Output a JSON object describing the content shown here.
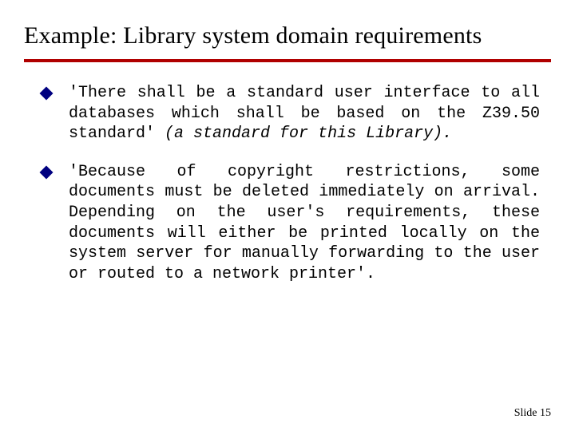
{
  "title": "Example: Library system domain requirements",
  "bullets": [
    {
      "main": "'There shall be a standard user interface to all databases which shall be based on the Z39.50 standard' ",
      "ital": "(a standard for this Library)."
    },
    {
      "main": "'Because of copyright restrictions, some documents must be deleted immediately on arrival. Depending on the user's requirements, these documents will either be printed locally on the system server for manually forwarding to the user or routed to a network printer'.",
      "ital": ""
    }
  ],
  "footer": "Slide 15"
}
